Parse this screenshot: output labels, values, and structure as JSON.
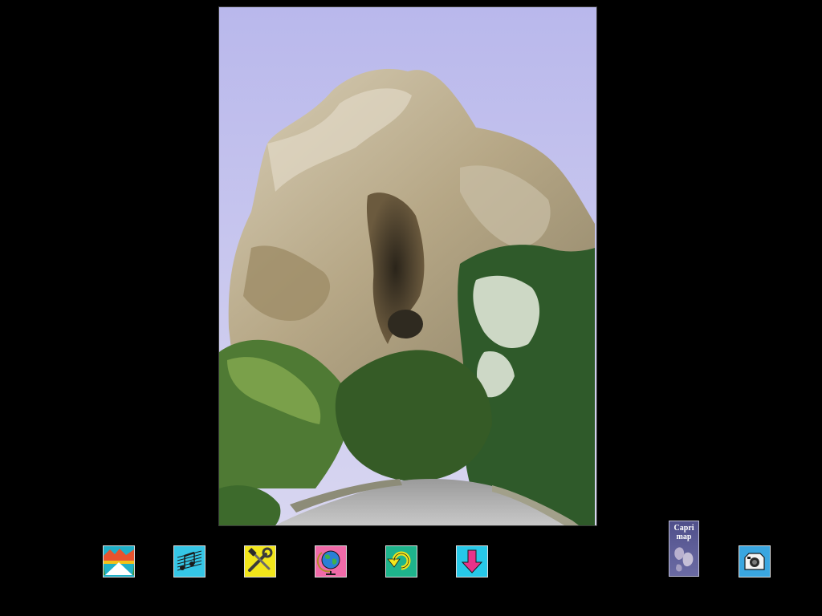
{
  "photo": {
    "subject": "rock-arch-photo"
  },
  "toolbar": {
    "buttons": [
      {
        "id": "home",
        "icon": "mountain-home-icon",
        "bg": "#1fb0c8"
      },
      {
        "id": "music",
        "icon": "music-notes-icon",
        "bg": "#35c6e6"
      },
      {
        "id": "tools",
        "icon": "tools-icon",
        "bg": "#f2e61b"
      },
      {
        "id": "globe",
        "icon": "globe-icon",
        "bg": "#f06aa8"
      },
      {
        "id": "back",
        "icon": "return-arrow-icon",
        "bg": "#1eb48c"
      },
      {
        "id": "down",
        "icon": "down-arrow-icon",
        "bg": "#27c8e8"
      },
      {
        "id": "camera",
        "icon": "camera-icon",
        "bg": "#3aa6e0"
      }
    ]
  },
  "map_button": {
    "line1": "Capri",
    "line2": "map"
  }
}
